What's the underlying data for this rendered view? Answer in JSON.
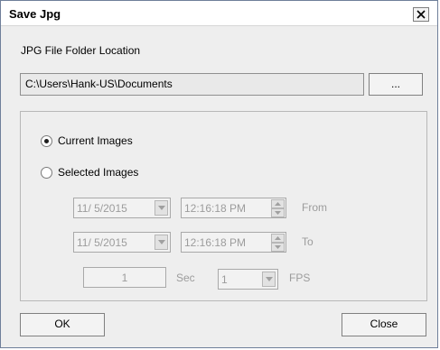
{
  "dialog": {
    "title": "Save Jpg",
    "close_icon": "close-x-icon"
  },
  "folder": {
    "label": "JPG File Folder Location",
    "path": "C:\\Users\\Hank-US\\Documents",
    "browse_label": "..."
  },
  "options": {
    "current_label": "Current Images",
    "current_checked": true,
    "selected_label": "Selected Images",
    "selected_checked": false
  },
  "range": {
    "from_date": "11/ 5/2015",
    "from_time": "12:16:18 PM",
    "from_label": "From",
    "to_date": "11/ 5/2015",
    "to_time": "12:16:18 PM",
    "to_label": "To",
    "seconds": "1",
    "sec_label": "Sec",
    "fps": "1",
    "fps_label": "FPS"
  },
  "buttons": {
    "ok": "OK",
    "close": "Close"
  },
  "colors": {
    "dialog_bg": "#eeeeee",
    "disabled_text": "#9c9c9c"
  }
}
